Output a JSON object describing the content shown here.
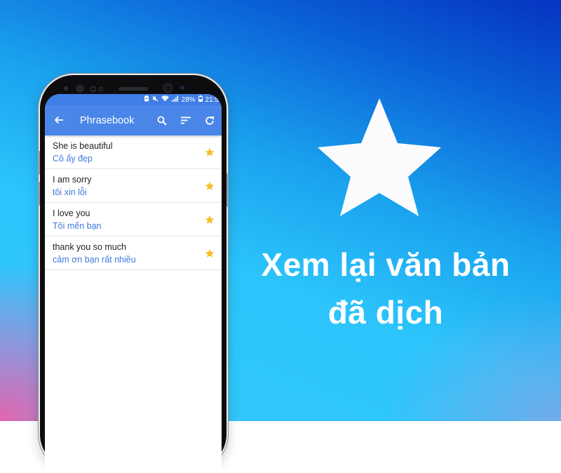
{
  "background": {
    "colors": {
      "top_right": "#0533c0",
      "center": "#2cc4fb",
      "bottom_left": "#ec60aa"
    }
  },
  "phone": {
    "status_bar": {
      "icons": [
        "battery-saver-icon",
        "mute-icon",
        "wifi-icon",
        "signal-icon"
      ],
      "battery_percent": "28%",
      "battery_icon": "battery-icon",
      "time": "21:5"
    },
    "app_bar": {
      "back_icon": "arrow-left-icon",
      "title": "Phrasebook",
      "actions": [
        "search-icon",
        "sort-icon",
        "refresh-icon"
      ],
      "color": "#4a86e8"
    },
    "phrases": [
      {
        "source": "She is beautiful",
        "translation": "Cô ấy đẹp",
        "starred": true
      },
      {
        "source": "I am sorry",
        "translation": "tôi xin lỗi",
        "starred": true
      },
      {
        "source": "I love you",
        "translation": "Tôi mến bạn",
        "starred": true
      },
      {
        "source": "thank you so much",
        "translation": "cảm ơn bạn rất nhiều",
        "starred": true
      }
    ],
    "star_color": "#f6c02c",
    "translation_color": "#3d7ad8"
  },
  "promo": {
    "icon": "star-icon",
    "headline_line1": "Xem lại văn bản",
    "headline_line2": "đã dịch"
  }
}
